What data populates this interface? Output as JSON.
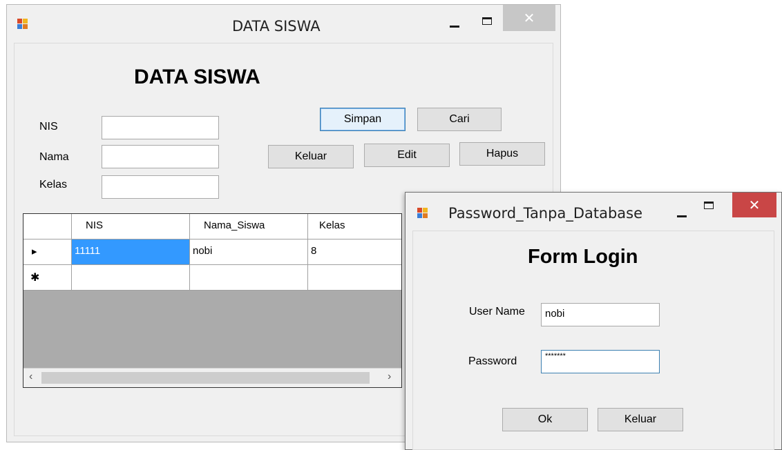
{
  "data_siswa": {
    "title": "DATA SISWA",
    "heading": "DATA SISWA",
    "fields": {
      "nis_label": "NIS",
      "nis_value": "",
      "nama_label": "Nama",
      "nama_value": "",
      "kelas_label": "Kelas",
      "kelas_value": ""
    },
    "buttons": {
      "simpan": "Simpan",
      "cari": "Cari",
      "keluar": "Keluar",
      "edit": "Edit",
      "hapus": "Hapus"
    },
    "grid": {
      "columns": [
        "NIS",
        "Nama_Siswa",
        "Kelas"
      ],
      "rows": [
        {
          "marker": "▸",
          "cells": [
            "11111",
            "nobi",
            "8"
          ]
        },
        {
          "marker": "✱",
          "cells": [
            "",
            "",
            ""
          ]
        }
      ]
    },
    "close_glyph": "✕"
  },
  "login": {
    "title": "Password_Tanpa_Database",
    "heading": "Form Login",
    "username_label": "User Name",
    "username_value": "nobi",
    "password_label": "Password",
    "password_value": "*******",
    "ok_label": "Ok",
    "keluar_label": "Keluar",
    "close_glyph": "✕"
  },
  "colors": {
    "window_bg": "#f0f0f0",
    "selection": "#3399ff",
    "close_active": "#c94646",
    "close_inactive": "#c7c7c7",
    "grid_empty": "#ababab"
  },
  "icons": [
    "app-icon",
    "minimize-icon",
    "maximize-icon",
    "close-icon",
    "current-row-icon",
    "new-row-icon",
    "scroll-left-icon",
    "scroll-right-icon"
  ]
}
